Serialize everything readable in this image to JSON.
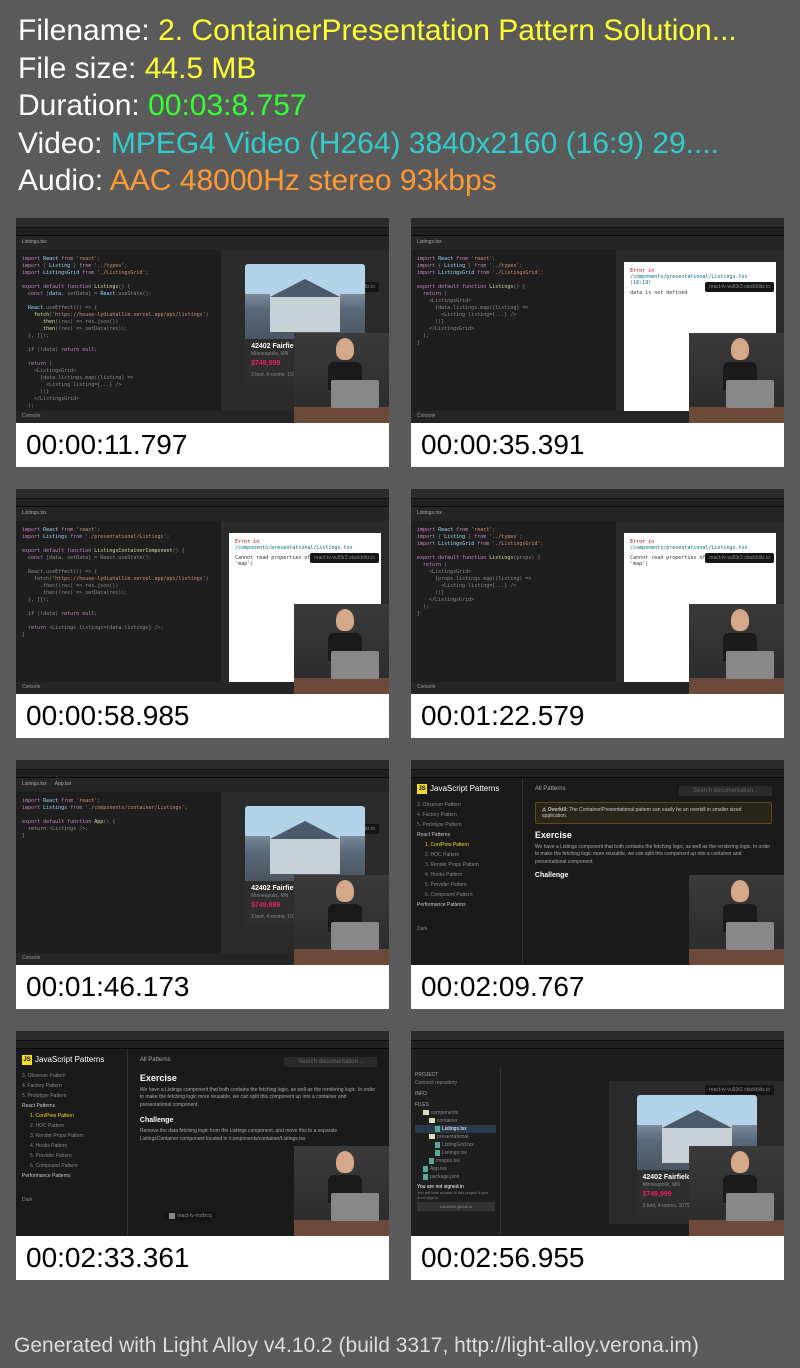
{
  "info": {
    "filename_label": "Filename: ",
    "filename_value": "2. ContainerPresentation Pattern Solution...",
    "filesize_label": "File size: ",
    "filesize_value": "44.5 MB",
    "duration_label": "Duration: ",
    "duration_value": "00:03:8.757",
    "video_label": "Video: ",
    "video_value": "MPEG4 Video (H264) 3840x2160 (16:9) 29....",
    "audio_label": "Audio: ",
    "audio_value": "AAC 48000Hz stereo 93kbps"
  },
  "thumbnails": [
    {
      "time": "00:00:11.797",
      "kind": "code_house"
    },
    {
      "time": "00:00:35.391",
      "kind": "code_error1"
    },
    {
      "time": "00:00:58.985",
      "kind": "code_error2"
    },
    {
      "time": "00:01:22.579",
      "kind": "code_error2"
    },
    {
      "time": "00:01:46.173",
      "kind": "code_house2"
    },
    {
      "time": "00:02:09.767",
      "kind": "docs_overkill"
    },
    {
      "time": "00:02:33.361",
      "kind": "docs_exercise"
    },
    {
      "time": "00:02:56.955",
      "kind": "file_tree_house"
    }
  ],
  "house": {
    "title": "42402 Fairfield Hill",
    "sub": "Minneapolis, MN",
    "price": "$749,999",
    "meta": "3 bed, 4 rooms, 10795"
  },
  "editor": {
    "tab1": "Listings.tsx",
    "tab2": "App.tsx",
    "url": "react-tv-vu93r2.stackblitz.io",
    "console": "Console"
  },
  "errors": {
    "err1_title": "Error in",
    "err1_path": "/components/presentational/Listings.tsx (18:19)",
    "err1_msg": "data is not defined",
    "err2_title": "Error in",
    "err2_path": "/components/presentational/Listings.tsx",
    "err2_msg": "Cannot read properties of undefined (reading 'map')"
  },
  "docs": {
    "brand": "JavaScript Patterns",
    "all": "All Patterns",
    "search": "Search documentation...",
    "nav_observer": "3. Observer Pattern",
    "nav_factory": "4. Factory Pattern",
    "nav_prototype": "5. Prototype Pattern",
    "nav_react_h": "React Patterns",
    "nav_conpres": "1. Con/Pres Pattern",
    "nav_hoc": "2. HOC Pattern",
    "nav_render": "3. Render Props Pattern",
    "nav_hooks": "4. Hooks Pattern",
    "nav_provider": "5. Provider Pattern",
    "nav_compound": "6. Compound Pattern",
    "nav_perf_h": "Performance Patterns",
    "nav_dark": "Dark",
    "overkill_label": "⚠ Overkill:",
    "overkill_text": " The Container/Presentational pattern can easily be an overkill in smaller sized application.",
    "h_exercise": "Exercise",
    "p_exercise": "We have a Listings component that both contains the fetching logic, as well as the rendering logic. In order to make the fetching logic more reusable, we can split this component up into a container and presentational component.",
    "h_challenge": "Challenge",
    "p_challenge": "Remove the data fetching logic from the Listings component, and move this to a separate ListingsContainer component located in /components/container/Listings.tsx",
    "sandbox": "react-tv-mufzcq"
  },
  "tree": {
    "project": "PROJECT",
    "connect": "Connect repository",
    "info": "INFO",
    "files": "FILES",
    "components": "components",
    "container": "container",
    "listings": "Listings.tsx",
    "presentational": "presentational",
    "listinggrid": "ListingGrid.tsx",
    "images": "images.tsx",
    "app": "App.tsx",
    "package": "package.json",
    "signin_title": "You are not signed in",
    "signin_text": "You will lose access to this project if you don't sign in.",
    "signin_url": "stackblitz.github.io"
  },
  "code": {
    "line_import1": "import React from 'react';",
    "line_import2": "import { Listing } from '../types';",
    "line_import3": "import ListingsGrid from './ListingsGrid';",
    "line_export": "export default function Listings() {",
    "line_const": "const [data, setData] = React.useState();",
    "line_effect": "React.useEffect(() => {",
    "line_fetch": "fetch('https://house-lydiahallie.vercel.app/api/listings')",
    "line_then1": ".then((res) => res.json())",
    "line_then2": ".then((res) => setData(res));",
    "line_close": "}, []);",
    "line_if": "if (!data) return null;",
    "line_return": "return (",
    "line_jsx1": "<ListingsGrid>",
    "line_map": "{data.listings.map((listing) => (",
    "line_jsx2": "<Listing key={listing.id} listing={...}",
    "line_close2": "))}",
    "line_close3": "</ListingsGrid>",
    "line_close4": ");"
  },
  "footer": "Generated with Light Alloy v4.10.2 (build 3317, http://light-alloy.verona.im)"
}
